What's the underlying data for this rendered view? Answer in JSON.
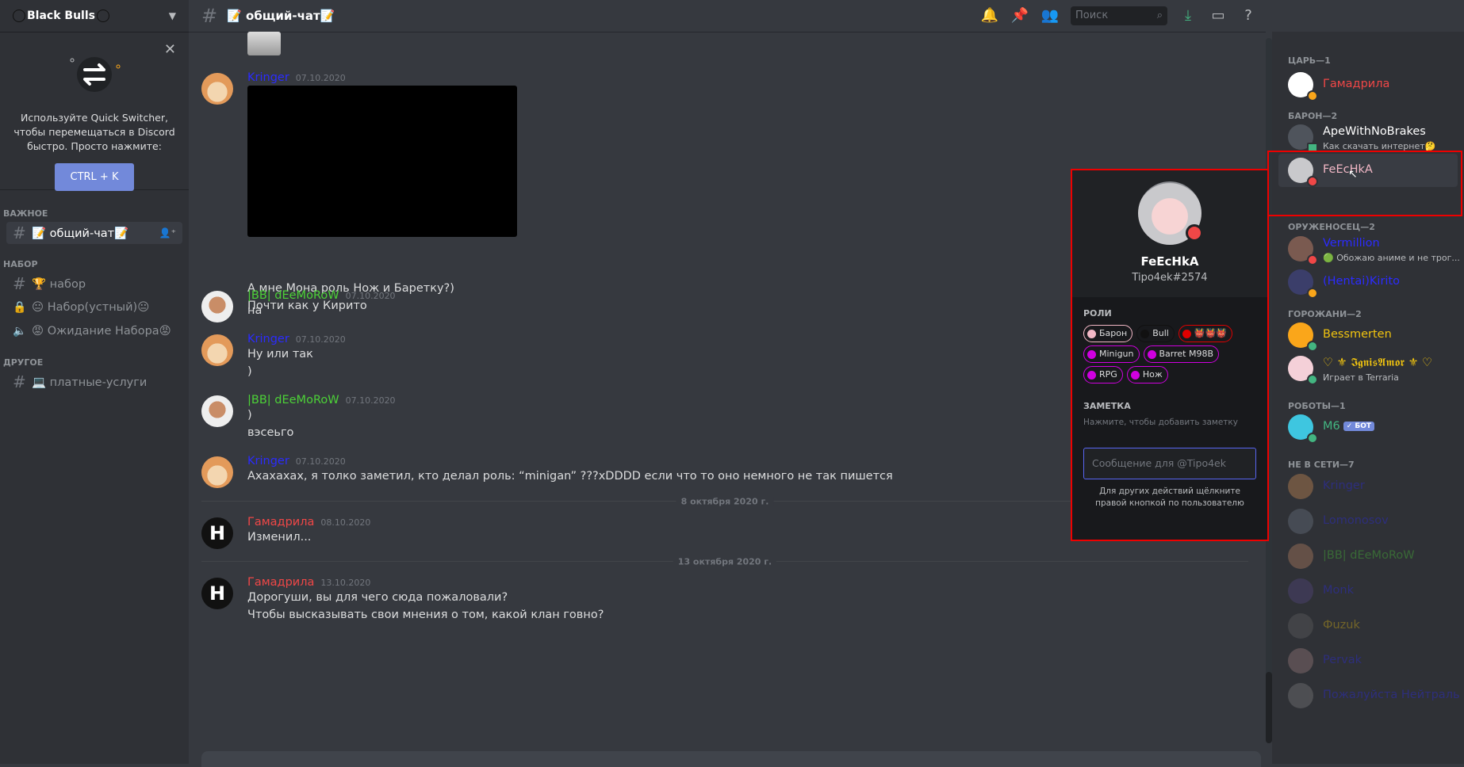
{
  "server": {
    "name": "Black Bulls"
  },
  "switcher": {
    "text": "Используйте Quick Switcher, чтобы перемещаться в Discord быстро. Просто нажмите:",
    "key": "CTRL + K"
  },
  "sidebar": {
    "cat_important": "ВАЖНОЕ",
    "ch_general": "📝 общий-чат📝",
    "cat_recruit": "НАБОР",
    "ch_recruit": "🏆 набор",
    "ch_voice_recruit": "😐 Набор(устный)😐",
    "ch_wait": "😡 Ожидание Набора😡",
    "cat_other": "ДРУГОЕ",
    "ch_paid": "💻 платные-услуги"
  },
  "header": {
    "channel": "📝 общий-чат📝",
    "search_placeholder": "Поиск"
  },
  "messages": {
    "m1": {
      "author": "Kringer",
      "time": "07.10.2020",
      "line1": "А мне Мона роль Нож и Баретку?)",
      "line2": "Почти как у Кирито"
    },
    "m2": {
      "author": "|BB| dEeMoRoW",
      "time": "07.10.2020",
      "line1": "на"
    },
    "m3": {
      "author": "Kringer",
      "time": "07.10.2020",
      "line1": "Ну или так",
      "line2": ")"
    },
    "m4": {
      "author": "|BB| dEeMoRoW",
      "time": "07.10.2020",
      "line1": ")",
      "line2": "вэсеьго"
    },
    "m5": {
      "author": "Kringer",
      "time": "07.10.2020",
      "line1": "Ахахахах, я толко заметил, кто делал роль: “minigan” ???xDDDD если что то оно немного не так пишется"
    },
    "div1": "8 октября 2020 г.",
    "m6": {
      "author": "Гамадрила",
      "time": "08.10.2020",
      "line1": "Изменил..."
    },
    "div2": "13 октября 2020 г.",
    "m7": {
      "author": "Гамадрила",
      "time": "13.10.2020",
      "line1": "Дорогуши, вы для чего сюда пожаловали?",
      "line2": "Чтобы высказывать свои мнения о том, какой клан говно?"
    }
  },
  "members": {
    "cat_tsar": "ЦАРЬ—1",
    "tsar1": "Гамадрила",
    "cat_baron": "БАРОН—2",
    "baron1": "ApeWithNoBrakes",
    "baron1_status": "Как скачать интернет🤔",
    "baron2": "FeEcHkA",
    "cat_squire": "ОРУЖЕНОСЕЦ—2",
    "squire1": "Vermillion",
    "squire1_status": "🟢 Обожаю аниме и не трог...",
    "squire2": "(Hentai)Kirito",
    "cat_town": "ГОРОЖАНИ—2",
    "town1": "Bessmerten",
    "town2": "♡ ⚜ 𝕴𝖌𝖓𝖎𝖘𝕬𝖒𝖔𝖗 ⚜ ♡",
    "town2_status": "Играет в Terraria",
    "cat_bots": "РОБОТЫ—1",
    "bot1": "M6",
    "bot_tag": "✓ БОТ",
    "cat_offline": "НЕ В СЕТИ—7",
    "off1": "Kringer",
    "off2": "Lomonosov",
    "off3": "|BB| dEeMoRoW",
    "off4": "Monk",
    "off5": "Фuzuk",
    "off6": "Pervak",
    "off7": "Пожалуйста Нейтраль"
  },
  "popout": {
    "name": "FeEcHkA",
    "tag": "Tipo4ek#2574",
    "roles_title": "РОЛИ",
    "roles": [
      {
        "name": "Барон",
        "color": "#f2b8c6"
      },
      {
        "name": "Bull",
        "color": "#111111"
      },
      {
        "name": "👹👹👹",
        "color": "#e00000"
      },
      {
        "name": "Minigun",
        "color": "#d000e0"
      },
      {
        "name": "Barret M98B",
        "color": "#d000e0"
      },
      {
        "name": "RPG",
        "color": "#d000e0"
      },
      {
        "name": "Нож",
        "color": "#d000e0"
      }
    ],
    "note_title": "ЗАМЕТКА",
    "note_placeholder": "Нажмите, чтобы добавить заметку",
    "message_placeholder": "Сообщение для @Tipo4ek",
    "hint": "Для других действий щёлкните правой кнопкой по пользователю"
  }
}
